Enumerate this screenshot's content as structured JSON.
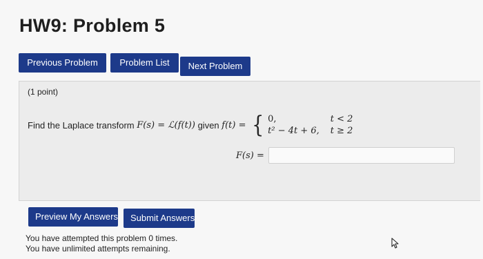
{
  "page": {
    "title": "HW9: Problem 5"
  },
  "nav": {
    "previous": "Previous Problem",
    "list": "Problem List",
    "next": "Next Problem"
  },
  "problem": {
    "points": "(1 point)",
    "prompt": "Find the Laplace transform",
    "lhs": "F(s) = ℒ(f(t))",
    "given": "given",
    "fdef": "f(t) =",
    "case1_expr": "0,",
    "case1_cond": "t < 2",
    "case2_expr": "t² − 4t + 6,",
    "case2_cond": "t ≥ 2",
    "answer_label": "F(s) =",
    "answer_value": ""
  },
  "actions": {
    "preview": "Preview My Answers",
    "submit": "Submit Answers"
  },
  "status": {
    "attempts": "You have attempted this problem 0 times.",
    "remaining": "You have unlimited attempts remaining."
  }
}
